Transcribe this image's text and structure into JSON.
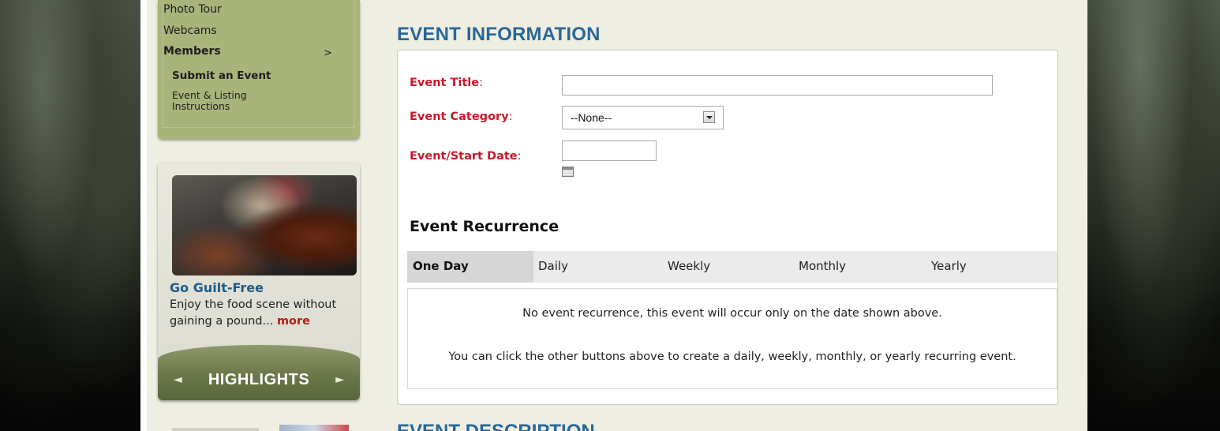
{
  "sidebar": {
    "nav": {
      "photo_tour": "Photo Tour",
      "webcams": "Webcams",
      "members": "Members",
      "members_arrow": ">",
      "submit_event": "Submit an Event",
      "instructions_line1": "Event & Listing",
      "instructions_line2": "Instructions"
    },
    "highlights": {
      "title": "Go Guilt-Free",
      "text": "Enjoy the food scene without gaining a pound...",
      "more": "more",
      "label": "HIGHLIGHTS",
      "prev": "◄",
      "next": "►"
    }
  },
  "main": {
    "section_title": "EVENT INFORMATION",
    "next_section_title": "EVENT DESCRIPTION",
    "fields": {
      "title_label": "Event Title",
      "category_label": "Event Category",
      "date_label": "Event/Start Date",
      "colon": ":",
      "title_value": "",
      "category_value": "--None--",
      "date_value": ""
    },
    "recurrence": {
      "title": "Event Recurrence",
      "tabs": [
        "One Day",
        "Daily",
        "Weekly",
        "Monthly",
        "Yearly"
      ],
      "active_tab": "One Day",
      "message_1": "No event recurrence, this event will occur only on the date shown above.",
      "message_2": "You can click the other buttons above to create a daily, weekly, monthly, or yearly recurring event."
    }
  },
  "colors": {
    "accent_blue": "#2a6796",
    "label_red": "#c8192b",
    "sidebar_green": "#a8b47a"
  }
}
